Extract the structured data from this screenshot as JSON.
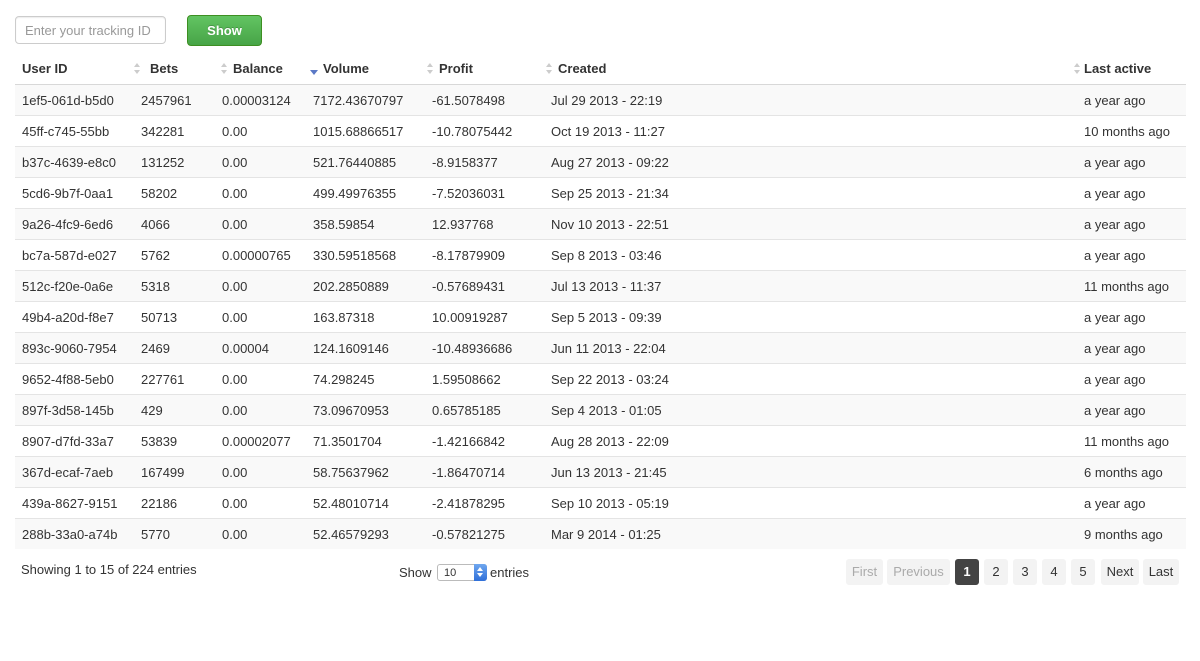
{
  "search": {
    "placeholder": "Enter your tracking ID",
    "button_label": "Show"
  },
  "table": {
    "columns": [
      "User ID",
      "Bets",
      "Balance",
      "Volume",
      "Profit",
      "Created",
      "Last active"
    ],
    "sort": {
      "column": "Volume",
      "direction": "descending"
    },
    "rows": [
      [
        "1ef5-061d-b5d0",
        "2457961",
        "0.00003124",
        "7172.43670797",
        "-61.5078498",
        "Jul 29 2013 - 22:19",
        "a year ago"
      ],
      [
        "45ff-c745-55bb",
        "342281",
        "0.00",
        "1015.68866517",
        "-10.78075442",
        "Oct 19 2013 - 11:27",
        "10 months ago"
      ],
      [
        "b37c-4639-e8c0",
        "131252",
        "0.00",
        "521.76440885",
        "-8.9158377",
        "Aug 27 2013 - 09:22",
        "a year ago"
      ],
      [
        "5cd6-9b7f-0aa1",
        "58202",
        "0.00",
        "499.49976355",
        "-7.52036031",
        "Sep 25 2013 - 21:34",
        "a year ago"
      ],
      [
        "9a26-4fc9-6ed6",
        "4066",
        "0.00",
        "358.59854",
        "12.937768",
        "Nov 10 2013 - 22:51",
        "a year ago"
      ],
      [
        "bc7a-587d-e027",
        "5762",
        "0.00000765",
        "330.59518568",
        "-8.17879909",
        "Sep 8 2013 - 03:46",
        "a year ago"
      ],
      [
        "512c-f20e-0a6e",
        "5318",
        "0.00",
        "202.2850889",
        "-0.57689431",
        "Jul 13 2013 - 11:37",
        "11 months ago"
      ],
      [
        "49b4-a20d-f8e7",
        "50713",
        "0.00",
        "163.87318",
        "10.00919287",
        "Sep 5 2013 - 09:39",
        "a year ago"
      ],
      [
        "893c-9060-7954",
        "2469",
        "0.00004",
        "124.1609146",
        "-10.48936686",
        "Jun 11 2013 - 22:04",
        "a year ago"
      ],
      [
        "9652-4f88-5eb0",
        "227761",
        "0.00",
        "74.298245",
        "1.59508662",
        "Sep 22 2013 - 03:24",
        "a year ago"
      ],
      [
        "897f-3d58-145b",
        "429",
        "0.00",
        "73.09670953",
        "0.65785185",
        "Sep 4 2013 - 01:05",
        "a year ago"
      ],
      [
        "8907-d7fd-33a7",
        "53839",
        "0.00002077",
        "71.3501704",
        "-1.42166842",
        "Aug 28 2013 - 22:09",
        "11 months ago"
      ],
      [
        "367d-ecaf-7aeb",
        "167499",
        "0.00",
        "58.75637962",
        "-1.86470714",
        "Jun 13 2013 - 21:45",
        "6 months ago"
      ],
      [
        "439a-8627-9151",
        "22186",
        "0.00",
        "52.48010714",
        "-2.41878295",
        "Sep 10 2013 - 05:19",
        "a year ago"
      ],
      [
        "288b-33a0-a74b",
        "5770",
        "0.00",
        "52.46579293",
        "-0.57821275",
        "Mar 9 2014 - 01:25",
        "9 months ago"
      ]
    ]
  },
  "info": {
    "text": "Showing 1 to 15 of 224 entries"
  },
  "length": {
    "show_label": "Show",
    "value": "10",
    "entries_label": "entries"
  },
  "pagination": {
    "first": "First",
    "previous": "Previous",
    "pages": [
      "1",
      "2",
      "3",
      "4",
      "5"
    ],
    "current": "1",
    "next": "Next",
    "last": "Last"
  },
  "colors": {
    "show_button": "#51b451",
    "sort_active": "#5b79c6",
    "current_page": "#444444"
  }
}
